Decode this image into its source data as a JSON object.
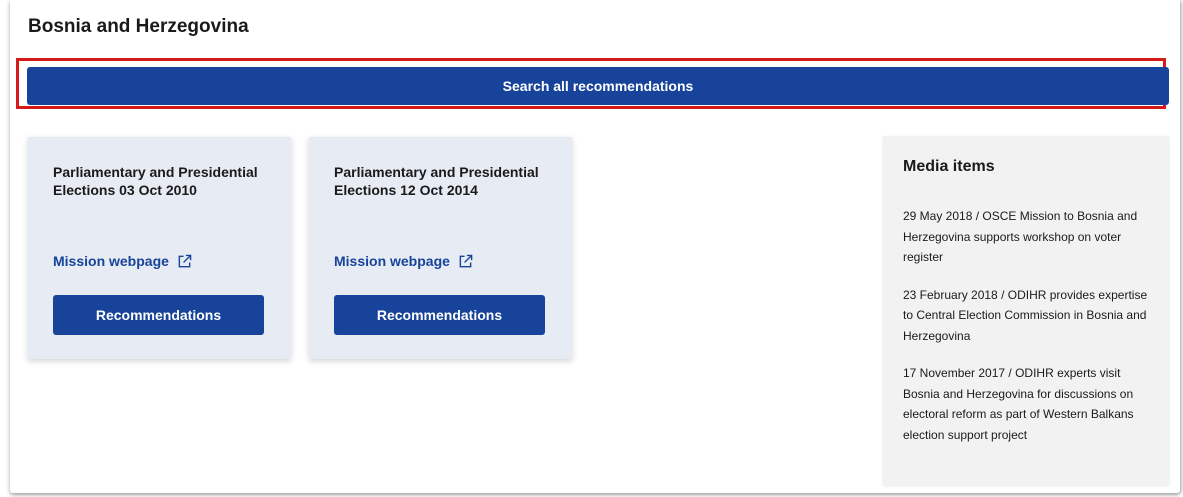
{
  "page": {
    "title": "Bosnia and Herzegovina"
  },
  "search": {
    "button_label": "Search all recommendations"
  },
  "missions": [
    {
      "title": "Parliamentary and Presidential Elections 03 Oct 2010",
      "link_label": "Mission webpage",
      "button_label": "Recommendations"
    },
    {
      "title": "Parliamentary and Presidential Elections 12 Oct 2014",
      "link_label": "Mission webpage",
      "button_label": "Recommendations"
    }
  ],
  "media": {
    "title": "Media items",
    "items": [
      "29 May 2018 / OSCE Mission to Bosnia and Herzegovina supports workshop on voter register",
      "23 February 2018 / ODIHR provides expertise to Central Election Commission in Bosnia and Herzegovina",
      "17 November 2017 / ODIHR experts visit Bosnia and Herzegovina for discussions on electoral reform as part of Western Balkans election support project"
    ]
  },
  "colors": {
    "primary": "#17449a",
    "highlight": "#d61a1a",
    "card_bg": "#e6ebf4",
    "media_bg": "#f2f2f2"
  },
  "icons": {
    "external_link": "external-link-icon"
  }
}
